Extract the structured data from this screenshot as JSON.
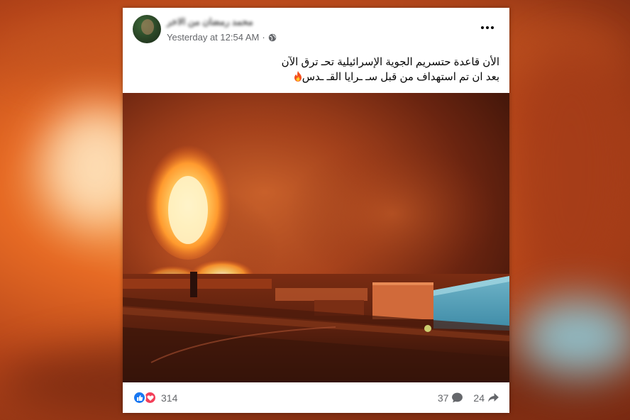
{
  "post": {
    "author_name": "محمد رمضان من الاخر",
    "timestamp": "Yesterday at 12:54 AM",
    "privacy_icon": "globe-icon",
    "text_line1": "الأن قاعدة حتسريم الجوية الإسرائيلية تحـ ترق الآن",
    "text_line2": "بعد ان تم استهداف من قبل سـ ـرايا القـ ـدس",
    "emoji": "fire-emoji"
  },
  "footer": {
    "reaction_count": "314",
    "comment_count": "37",
    "share_count": "24",
    "reaction_icons": [
      "like-icon",
      "love-icon"
    ]
  },
  "colors": {
    "like_blue": "#1877f2",
    "love_red": "#f33e58",
    "secondary_text": "#65676b"
  }
}
